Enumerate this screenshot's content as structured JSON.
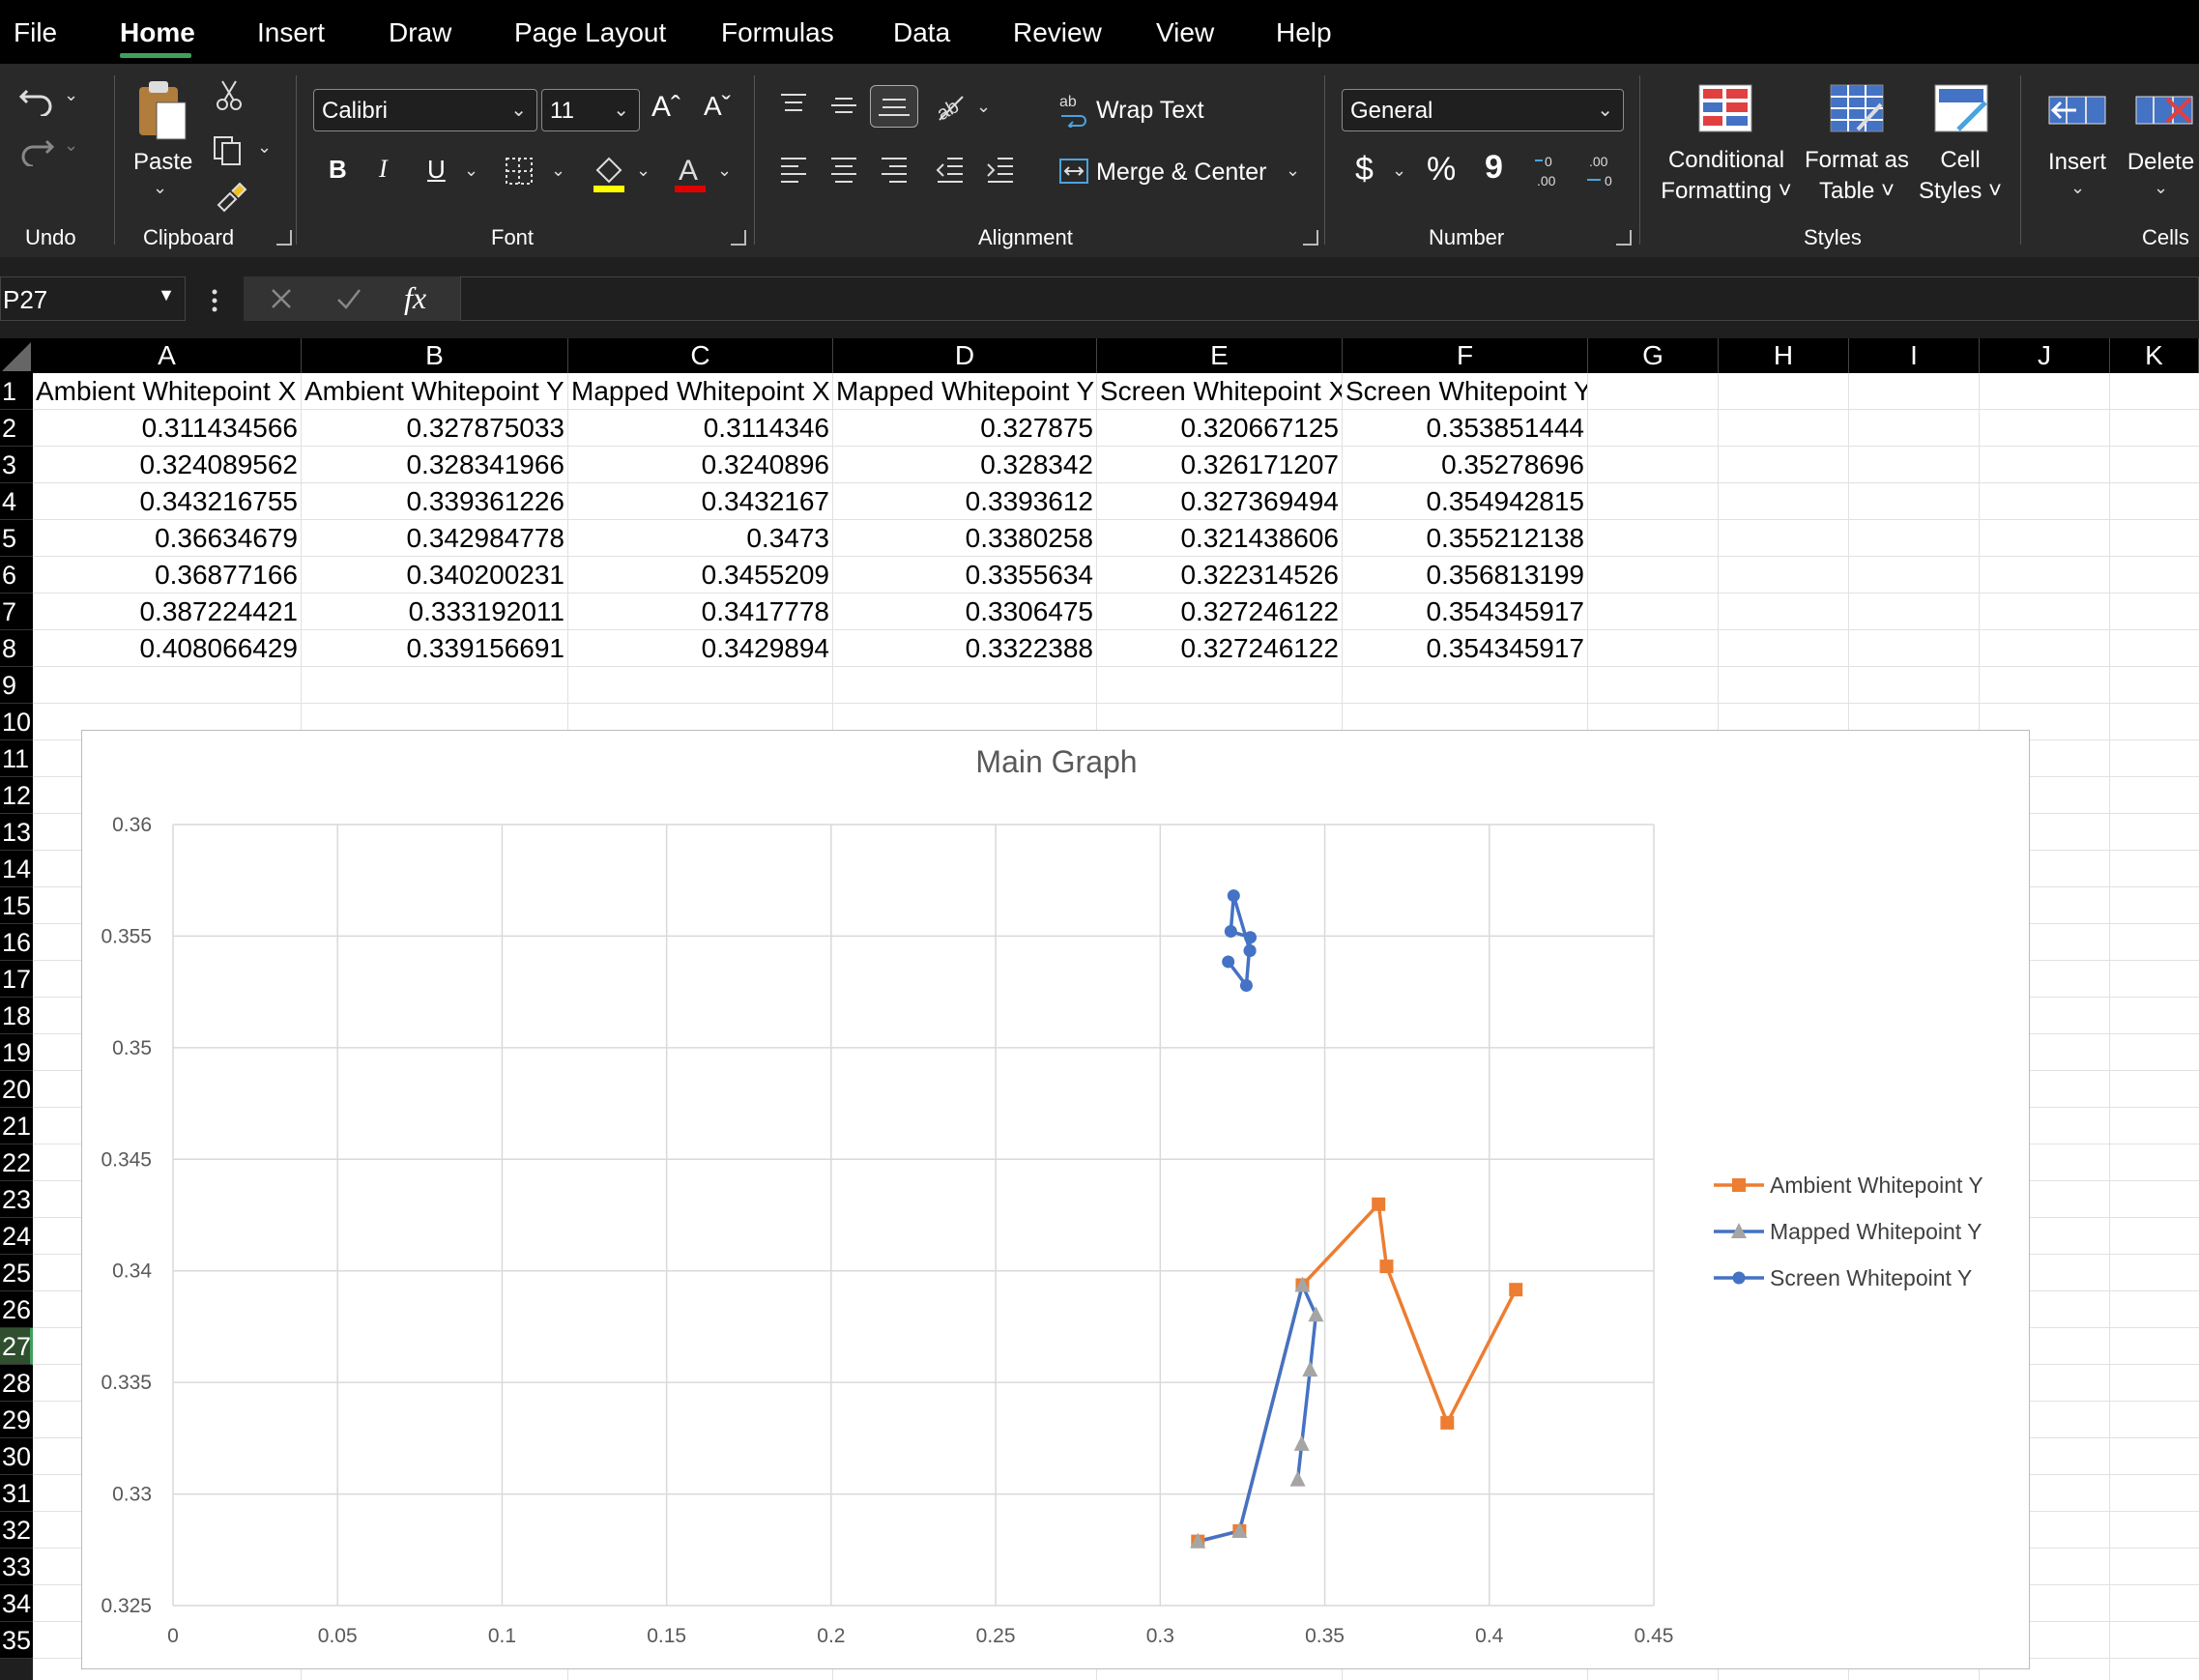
{
  "menu": {
    "items": [
      "File",
      "Home",
      "Insert",
      "Draw",
      "Page Layout",
      "Formulas",
      "Data",
      "Review",
      "View",
      "Help"
    ],
    "active": "Home"
  },
  "ribbon": {
    "groups": {
      "undo": "Undo",
      "clipboard": "Clipboard",
      "font": "Font",
      "alignment": "Alignment",
      "number": "Number",
      "styles": "Styles",
      "cells": "Cells"
    },
    "paste": "Paste",
    "font_name": "Calibri",
    "font_size": "11",
    "bold": "B",
    "italic": "I",
    "underline": "U",
    "grow_font": "Aˆ",
    "shrink_font": "Aˇ",
    "wrap_text": "Wrap Text",
    "merge_center": "Merge & Center",
    "number_format": "General",
    "currency": "$",
    "percent": "%",
    "comma": "9",
    "conditional_formatting": [
      "Conditional",
      "Formatting ˅"
    ],
    "format_as_table": [
      "Format as",
      "Table ˅"
    ],
    "cell_styles": [
      "Cell",
      "Styles ˅"
    ],
    "insert": "Insert",
    "delete": "Delete"
  },
  "formula_bar": {
    "name_box": "P27",
    "fx": "fx",
    "value": ""
  },
  "columns": [
    "A",
    "B",
    "C",
    "D",
    "E",
    "F",
    "G",
    "H",
    "I",
    "J",
    "K"
  ],
  "rows": [
    "1",
    "2",
    "3",
    "4",
    "5",
    "6",
    "7",
    "8",
    "9",
    "10",
    "11",
    "12",
    "13",
    "14",
    "15",
    "16",
    "17",
    "18",
    "19",
    "20",
    "21",
    "22",
    "23",
    "24",
    "25",
    "26",
    "27",
    "28",
    "29",
    "30",
    "31",
    "32",
    "33",
    "34",
    "35"
  ],
  "selected_row": "27",
  "table": {
    "headers": [
      "Ambient Whitepoint X",
      "Ambient Whitepoint Y",
      "Mapped Whitepoint X",
      "Mapped Whitepoint Y",
      "Screen Whitepoint X",
      "Screen Whitepoint Y"
    ],
    "rows": [
      [
        "0.311434566",
        "0.327875033",
        "0.3114346",
        "0.327875",
        "0.320667125",
        "0.353851444"
      ],
      [
        "0.324089562",
        "0.328341966",
        "0.3240896",
        "0.328342",
        "0.326171207",
        "0.35278696"
      ],
      [
        "0.343216755",
        "0.339361226",
        "0.3432167",
        "0.3393612",
        "0.327369494",
        "0.354942815"
      ],
      [
        "0.36634679",
        "0.342984778",
        "0.3473",
        "0.3380258",
        "0.321438606",
        "0.355212138"
      ],
      [
        "0.36877166",
        "0.340200231",
        "0.3455209",
        "0.3355634",
        "0.322314526",
        "0.356813199"
      ],
      [
        "0.387224421",
        "0.333192011",
        "0.3417778",
        "0.3306475",
        "0.327246122",
        "0.354345917"
      ],
      [
        "0.408066429",
        "0.339156691",
        "0.3429894",
        "0.3322388",
        "0.327246122",
        "0.354345917"
      ]
    ]
  },
  "chart_data": {
    "type": "scatter",
    "title": "Main Graph",
    "xlim": [
      0,
      0.45
    ],
    "ylim": [
      0.325,
      0.36
    ],
    "x_ticks": [
      "0",
      "0.05",
      "0.1",
      "0.15",
      "0.2",
      "0.25",
      "0.3",
      "0.35",
      "0.4",
      "0.45"
    ],
    "y_ticks": [
      "0.325",
      "0.33",
      "0.335",
      "0.34",
      "0.345",
      "0.35",
      "0.355",
      "0.36"
    ],
    "grid": true,
    "legend_position": "right",
    "series": [
      {
        "name": "Ambient Whitepoint Y",
        "color": "#ed7d31",
        "marker": "square",
        "x": [
          0.311434566,
          0.324089562,
          0.343216755,
          0.36634679,
          0.36877166,
          0.387224421,
          0.408066429
        ],
        "y": [
          0.327875033,
          0.328341966,
          0.339361226,
          0.342984778,
          0.340200231,
          0.333192011,
          0.339156691
        ]
      },
      {
        "name": "Mapped Whitepoint Y",
        "color": "#a5a5a5",
        "line_color": "#4472c4",
        "marker": "triangle",
        "x": [
          0.3114346,
          0.3240896,
          0.3432167,
          0.3473,
          0.3455209,
          0.3417778,
          0.3429894
        ],
        "y": [
          0.327875,
          0.328342,
          0.3393612,
          0.3380258,
          0.3355634,
          0.3306475,
          0.3322388
        ]
      },
      {
        "name": "Screen Whitepoint Y",
        "color": "#4472c4",
        "marker": "circle",
        "x": [
          0.320667125,
          0.326171207,
          0.327369494,
          0.321438606,
          0.322314526,
          0.327246122,
          0.327246122
        ],
        "y": [
          0.353851444,
          0.35278696,
          0.354942815,
          0.355212138,
          0.356813199,
          0.354345917,
          0.354345917
        ]
      }
    ]
  }
}
